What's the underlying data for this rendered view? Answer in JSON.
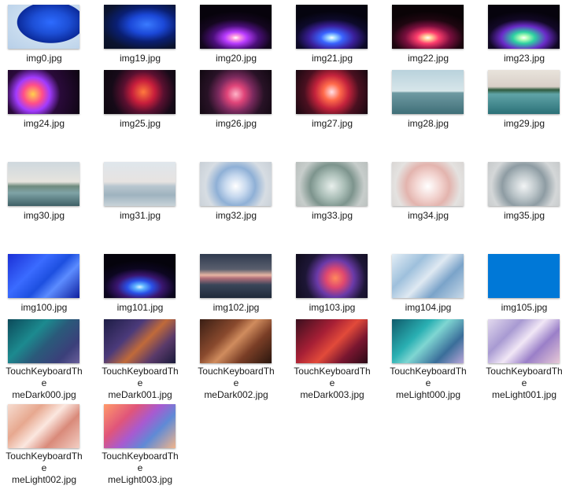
{
  "files": [
    {
      "name": "img0.jpg",
      "bg": "radial-gradient(ellipse at 60% 40%, #2d6bff 0%, #1d4fd6 30%, #0b2a9a 55%, #c9dcef 56%, #b7cfe8 100%)"
    },
    {
      "name": "img19.jpg",
      "bg": "radial-gradient(ellipse at 60% 45%, #3a7bff 0%, #1b48d8 28%, #0a1f73 50%, #0b1430 75%, #0a0f22 100%)"
    },
    {
      "name": "img20.jpg",
      "bg": "radial-gradient(ellipse 70% 60% at 50% 75%, #ffffff 0%, #ff9be0 8%, #b93cff 22%, #4b0f7a 45%, #14061f 70%, #07030c 100%)"
    },
    {
      "name": "img21.jpg",
      "bg": "radial-gradient(ellipse 70% 60% at 50% 75%, #ffffff 0%, #9fd9ff 8%, #3a64ff 22%, #3a1f9a 45%, #0d0a2a 70%, #05040f 100%)"
    },
    {
      "name": "img22.jpg",
      "bg": "radial-gradient(ellipse 70% 60% at 50% 75%, #ffffff 0%, #ffd19a 8%, #ff3e6e 22%, #7a0f3e 45%, #1e0610 70%, #0a0306 100%)"
    },
    {
      "name": "img23.jpg",
      "bg": "radial-gradient(ellipse 70% 60% at 50% 75%, #ffffff 0%, #b6ffb9 8%, #2ed1a2 22%, #6a2bc9 45%, #120826 70%, #06030d 100%)"
    },
    {
      "name": "img24.jpg",
      "bg": "radial-gradient(circle at 35% 55%, #ffd24a 0%, #ff4e8a 18%, #a23bff 32%, #2a0a3a 52%, #0d0510 100%)"
    },
    {
      "name": "img25.jpg",
      "bg": "radial-gradient(circle at 55% 50%, #ff7a3d 0%, #c81e3c 25%, #5a1030 45%, #160a18 70%, #0c070e 100%)"
    },
    {
      "name": "img26.jpg",
      "bg": "radial-gradient(circle at 50% 55%, #ffb3c7 0%, #e0457a 20%, #7b2a5e 40%, #281226 65%, #100810 100%)"
    },
    {
      "name": "img27.jpg",
      "bg": "radial-gradient(circle at 50% 50%, #ffe0e8 0%, #ff6a4a 20%, #c4233c 40%, #4a1020 65%, #170810 100%)"
    },
    {
      "name": "img28.jpg",
      "bg": "linear-gradient(180deg, #b9d2dc 0%, #d7e6ea 48%, #6f9aa2 52%, #3f6f78 100%)"
    },
    {
      "name": "img29.jpg",
      "bg": "linear-gradient(180deg, #e8e3dc 0%, #d9cfc7 38%, #2f5a3e 45%, #5fa4a7 55%, #2c7178 100%)"
    },
    {
      "name": "img30.jpg",
      "bg": "linear-gradient(180deg, #cfd8de 0%, #e6e4de 45%, #6e8a7e 55%, #7fa3a6 70%, #3e6066 100%)"
    },
    {
      "name": "img31.jpg",
      "bg": "linear-gradient(180deg, #dfe6ec 0%, #e7e3e1 45%, #b8c6cf 55%, #9fb3bf 75%, #c9d3d9 100%)"
    },
    {
      "name": "img32.jpg",
      "bg": "radial-gradient(circle at 50% 55%, #ffffff 0%, #c6d8ee 25%, #8fb0d6 45%, #d7dde3 70%, #c8cfd6 100%)"
    },
    {
      "name": "img33.jpg",
      "bg": "radial-gradient(circle at 50% 55%, #e8efec 0%, #a9bdb6 30%, #7d948d 50%, #c7cdcb 75%, #b9bfbd 100%)"
    },
    {
      "name": "img34.jpg",
      "bg": "radial-gradient(circle at 50% 55%, #ffffff 0%, #f2d3cf 30%, #e3b4ae 50%, #e4e2e0 75%, #d9d6d4 100%)"
    },
    {
      "name": "img35.jpg",
      "bg": "radial-gradient(circle at 50% 55%, #f2f4f5 0%, #b9c3c7 30%, #8e9ca3 50%, #d4d7d8 75%, #c6c9ca 100%)"
    },
    {
      "name": "img100.jpg",
      "bg": "linear-gradient(135deg, #1b2fd6 0%, #3a6bff 35%, #1d4fe0 55%, #5c8cff 70%, #0f1f9e 100%)"
    },
    {
      "name": "img101.jpg",
      "bg": "radial-gradient(ellipse 70% 60% at 50% 75%, #d8f4ff 0%, #5fb4ff 10%, #2a50e8 25%, #3a1670 45%, #0c0620 70%, #05030c 100%)"
    },
    {
      "name": "img102.jpg",
      "bg": "linear-gradient(180deg, #2f3a4e 0%, #5a5f6e 35%, #e8b5a3 48%, #b3707a 55%, #3a4659 70%, #1f2a3a 100%)"
    },
    {
      "name": "img103.jpg",
      "bg": "radial-gradient(circle at 55% 55%, #ff8a5c 0%, #e0486f 20%, #6a3aa8 40%, #1d1636 65%, #0e0b1a 100%)"
    },
    {
      "name": "img104.jpg",
      "bg": "linear-gradient(135deg, #e4eef6 0%, #9ec0dc 30%, #dfe9f2 50%, #7aa3c9 70%, #c8d9e8 100%)"
    },
    {
      "name": "img105.jpg",
      "bg": "#0078d7"
    },
    {
      "name": "TouchKeyboardThemeDark000.jpg",
      "bg": "linear-gradient(135deg, #0c4a5a 0%, #1c8a8f 35%, #2a5a7a 55%, #3b3f7a 80%, #6a5f9a 100%)"
    },
    {
      "name": "TouchKeyboardThemeDark001.jpg",
      "bg": "linear-gradient(135deg, #1d1d45 0%, #4b3a7a 35%, #c06a3a 55%, #5a3a6a 75%, #1a1a3a 100%)"
    },
    {
      "name": "TouchKeyboardThemeDark002.jpg",
      "bg": "linear-gradient(135deg, #3a1e14 0%, #8a4a2e 35%, #d08c5e 50%, #7a3e26 70%, #2a160e 100%)"
    },
    {
      "name": "TouchKeyboardThemeDark003.jpg",
      "bg": "linear-gradient(135deg, #3a0f1e 0%, #a61f35 35%, #e24a3a 55%, #7a1630 75%, #2a0a16 100%)"
    },
    {
      "name": "TouchKeyboardThemeLight000.jpg",
      "bg": "linear-gradient(135deg, #0f5a6a 0%, #2ab0b3 35%, #7fd6d2 50%, #3a6e9a 75%, #b9a6d8 100%)"
    },
    {
      "name": "TouchKeyboardThemeLight001.jpg",
      "bg": "linear-gradient(135deg, #e2d9ee 0%, #a89ad2 30%, #f1e7f6 50%, #9a7fc8 70%, #e7c9d6 100%)"
    },
    {
      "name": "TouchKeyboardThemeLight002.jpg",
      "bg": "linear-gradient(135deg, #f6dcd0 0%, #e7a88f 30%, #fbe7df 50%, #d98a7a 70%, #f3cfc4 100%)"
    },
    {
      "name": "TouchKeyboardThemeLight003.jpg",
      "bg": "linear-gradient(135deg, #ff9a6a 0%, #e0557a 30%, #a85ad0 50%, #5f8ad6 70%, #f2b48a 100%)"
    }
  ]
}
